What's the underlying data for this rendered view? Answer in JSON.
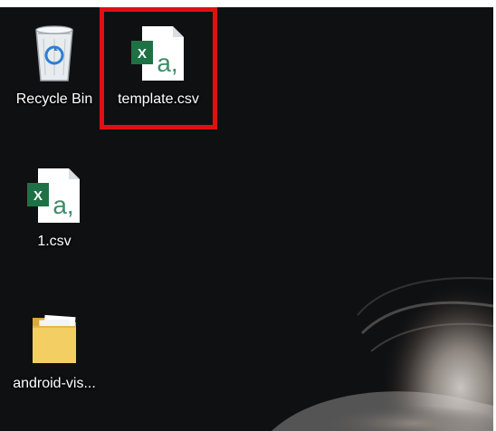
{
  "desktop": {
    "icons": [
      {
        "label": "Recycle Bin",
        "icon": "recycle-bin-icon"
      },
      {
        "label": "template.csv",
        "icon": "excel-csv-file-icon",
        "selected": true
      },
      {
        "label": "1.csv",
        "icon": "excel-csv-file-icon"
      },
      {
        "label": "android-vis...",
        "icon": "folder-icon"
      }
    ]
  },
  "colors": {
    "selection_box": "#e01010",
    "excel_green": "#1e7145",
    "folder_yellow": "#f3cf63",
    "label_text": "#ffffff"
  }
}
